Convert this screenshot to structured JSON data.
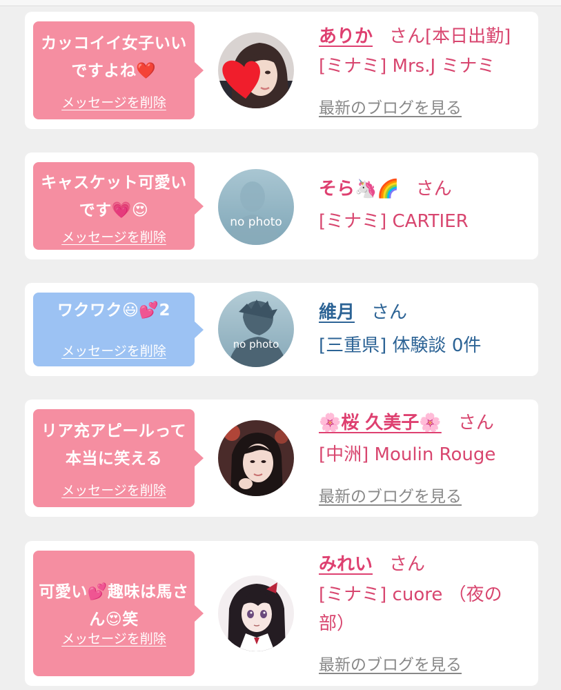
{
  "colors": {
    "pink_bubble": "#f58ea1",
    "blue_bubble": "#9cc2f3",
    "pink_text": "#de4070",
    "blue_text": "#2c6395",
    "link_gray": "#888888"
  },
  "messages": [
    {
      "text": "カッコイイ女子いいですよね❤️",
      "delete_label": "メッセージを削除",
      "name": "ありか",
      "honorific": "さん",
      "status": "[本日出勤]",
      "shop": "[ミナミ] Mrs.J ミナミ",
      "blog_label": "最新のブログを見る",
      "avatar": "photo-woman-heart"
    },
    {
      "text": "キャスケット可愛いです💗😍",
      "delete_label": "メッセージを削除",
      "name": "そら🦄🌈",
      "honorific": "さん",
      "shop": "[ミナミ] CARTIER",
      "avatar": "no-photo",
      "avatar_text": "no photo"
    },
    {
      "text": "ワクワク😃💕2",
      "delete_label": "メッセージを削除",
      "name": "維月",
      "honorific": "さん",
      "shop": "[三重県] 体験談 0件",
      "avatar": "no-photo-silhouette",
      "avatar_text": "no photo"
    },
    {
      "text": "リア充アピールって本当に笑える",
      "delete_label": "メッセージを削除",
      "name": "🌸桜 久美子🌸",
      "honorific": "さん",
      "shop": "[中洲] Moulin Rouge",
      "blog_label": "最新のブログを見る",
      "avatar": "photo-woman"
    },
    {
      "text": "可愛い💕趣味は馬さん😍笑",
      "delete_label": "メッセージを削除",
      "name": "みれい",
      "honorific": "さん",
      "shop": "[ミナミ] cuore （夜の部）",
      "blog_label": "最新のブログを見る",
      "avatar": "anime-girl"
    }
  ]
}
